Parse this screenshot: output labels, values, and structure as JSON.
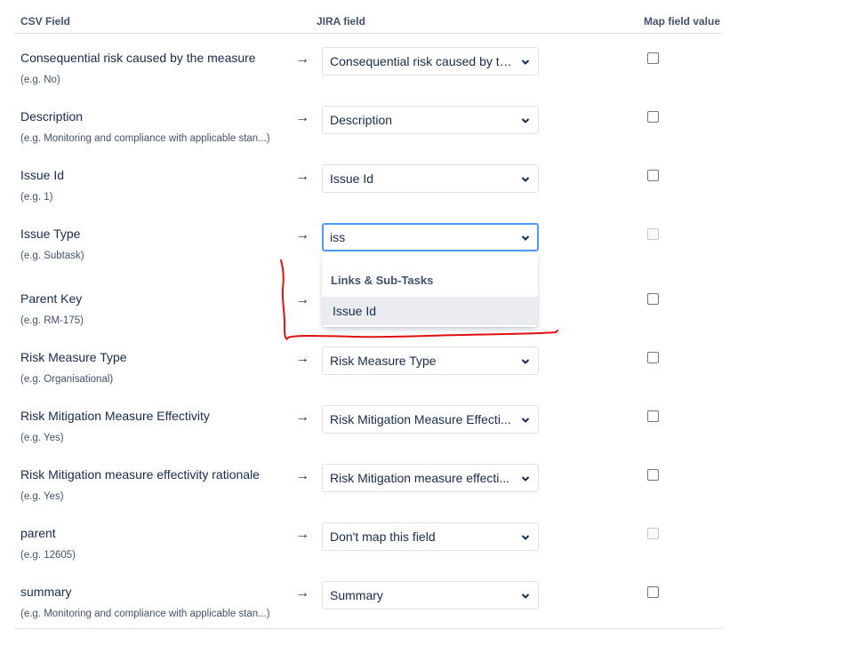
{
  "headers": {
    "csv_field": "CSV Field",
    "jira_field": "JIRA field",
    "map_field_value": "Map field value"
  },
  "arrow": "→",
  "rows": [
    {
      "name": "Consequential risk caused by the measure",
      "example": "(e.g.  No)",
      "jira": "Consequential risk caused by th...",
      "map_checked": false,
      "map_disabled": false
    },
    {
      "name": "Description",
      "example": "(e.g.  Monitoring and compliance with applicable stan...)",
      "jira": "Description",
      "map_checked": false,
      "map_disabled": false
    },
    {
      "name": "Issue Id",
      "example": "(e.g.  1)",
      "jira": "Issue Id",
      "map_checked": false,
      "map_disabled": false
    },
    {
      "name": "Issue Type",
      "example": "(e.g.  Subtask)",
      "jira": "iss",
      "map_checked": false,
      "map_disabled": true
    },
    {
      "name": "Parent Key",
      "example": "(e.g.  RM-175)",
      "jira": "",
      "map_checked": false,
      "map_disabled": false
    },
    {
      "name": "Risk Measure Type",
      "example": "(e.g.  Organisational)",
      "jira": "Risk Measure Type",
      "map_checked": false,
      "map_disabled": false
    },
    {
      "name": "Risk Mitigation Measure Effectivity",
      "example": "(e.g.  Yes)",
      "jira": "Risk Mitigation Measure Effecti...",
      "map_checked": false,
      "map_disabled": false
    },
    {
      "name": "Risk Mitigation measure effectivity rationale",
      "example": "(e.g.  Yes)",
      "jira": "Risk Mitigation measure effecti...",
      "map_checked": false,
      "map_disabled": false
    },
    {
      "name": "parent",
      "example": "(e.g.  12605)",
      "jira": "Don't map this field",
      "map_checked": false,
      "map_disabled": true
    },
    {
      "name": "summary",
      "example": "(e.g.  Monitoring and compliance with applicable stan...)",
      "jira": "Summary",
      "map_checked": false,
      "map_disabled": false
    }
  ],
  "dropdown": {
    "group_label": "Links & Sub-Tasks",
    "options": [
      "Issue Id"
    ]
  },
  "colors": {
    "focus_border": "#4c9aff",
    "annotation_red": "#e01010",
    "option_highlight": "#ebecf0"
  },
  "icons": {
    "select": "chevron-down-icon",
    "arrow": "right-arrow-icon"
  }
}
